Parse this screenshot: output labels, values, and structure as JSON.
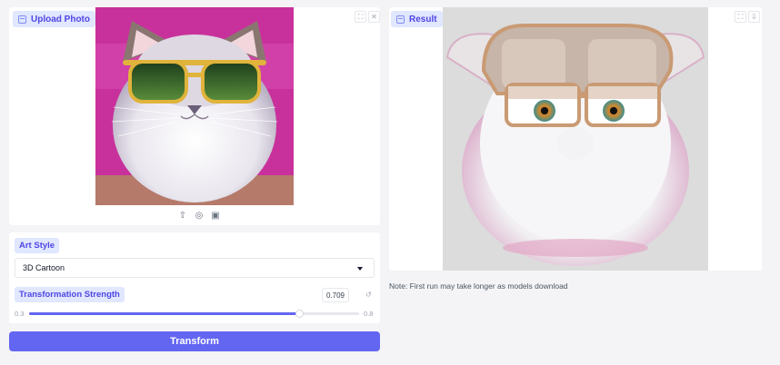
{
  "upload": {
    "label": "Upload Photo",
    "icons": [
      "fullscreen-icon",
      "close-icon",
      "upload-icon",
      "webcam-icon",
      "clipboard-icon"
    ]
  },
  "result": {
    "label": "Result",
    "icons": [
      "fullscreen-icon",
      "download-icon"
    ]
  },
  "art_style": {
    "label": "Art Style",
    "selected": "3D Cartoon"
  },
  "strength": {
    "label": "Transformation Strength",
    "value": "0.709",
    "min": "0.3",
    "max": "0.8",
    "fraction": 0.818,
    "reset_icon": "reset-icon"
  },
  "actions": {
    "transform_label": "Transform"
  },
  "note": "Note: First run may take longer as models download",
  "colors": {
    "accent": "#6366f1",
    "tag_bg": "#e0e7ff",
    "tag_text": "#4f46e5",
    "upload_bg": "#c8319c",
    "result_bg": "#dcdcdc"
  }
}
